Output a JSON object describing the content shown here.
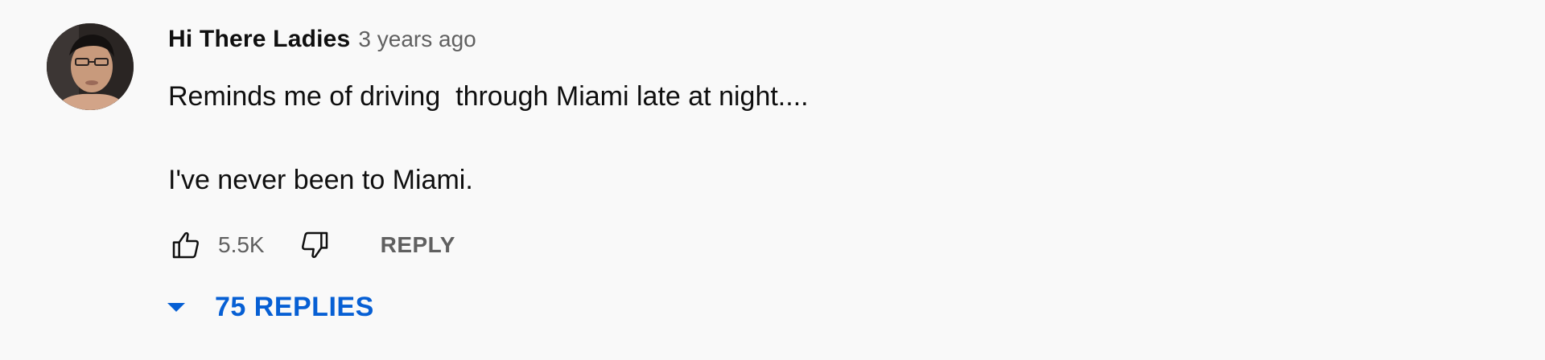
{
  "comment": {
    "author": "Hi There Ladies",
    "timestamp": "3 years ago",
    "text_lines": [
      "Reminds me of driving  through Miami late at night....",
      "",
      "I've never been to Miami."
    ],
    "like_count": "5.5K",
    "reply_label": "REPLY",
    "replies_label": "75 REPLIES",
    "avatar_icon": "user-avatar"
  },
  "colors": {
    "background": "#f9f9f9",
    "text_primary": "#0f0f0f",
    "text_secondary": "#606060",
    "link_blue": "#065fd4"
  }
}
